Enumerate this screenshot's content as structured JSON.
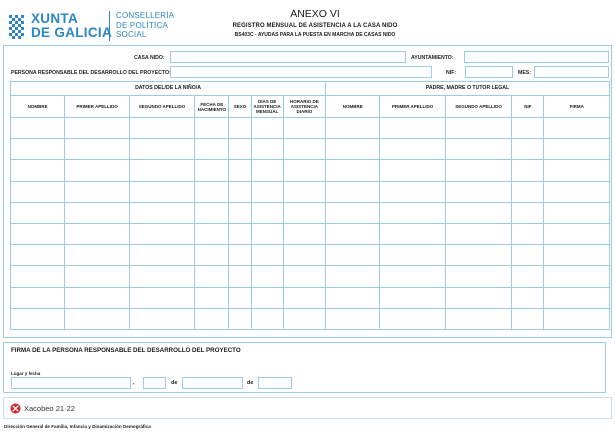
{
  "header": {
    "logo_line1": "XUNTA",
    "logo_line2": "DE GALICIA",
    "dept_line1": "CONSELLERÍA",
    "dept_line2": "DE POLÍTICA",
    "dept_line3": "SOCIAL",
    "annex": "ANEXO VI",
    "title": "REGISTRO MENSUAL DE ASISTENCIA A LA CASA NIDO",
    "subtitle": "BS403C - AYUDAS PARA LA PUESTA EN MARCHA DE CASAS NIDO"
  },
  "form": {
    "casa_nido_label": "CASA NIDO:",
    "ayuntamiento_label": "AYUNTAMIENTO:",
    "responsable_label": "PERSONA RESPONSABLE DEL DESARROLLO DEL PROYECTO:",
    "nif_label": "NIF:",
    "mes_label": "MES:"
  },
  "table": {
    "group_left": "DATOS DEL/DE LA NIÑO/A",
    "group_right": "PADRE, MADRE O TUTOR LEGAL",
    "columns_left": [
      "NOMBRE",
      "PRIMER APELLIDO",
      "SEGUNDO APELLIDO",
      "FECHA DE NACIMIENTO",
      "SEXO",
      "DÍAS DE ASISTENCIA MENSUAL",
      "HORARIO DE ASISTENCIA DIARIO"
    ],
    "columns_right": [
      "NOMBRE",
      "PRIMER APELLIDO",
      "SEGUNDO APELLIDO",
      "NIF",
      "FIRMA"
    ]
  },
  "signature": {
    "title": "FIRMA DE LA PERSONA RESPONSABLE DEL DESARROLLO DEL PROYECTO",
    "place_label": "Lugar y fecha",
    "comma": ",",
    "de1": "de",
    "de2": "de"
  },
  "xacobeo": {
    "text": "Xacobeo 21·22"
  },
  "footer": {
    "text": "Dirección General de Familia, Infancia y Dinamización Demográfica"
  },
  "colors": {
    "accent": "#2b86c8",
    "border": "#9ccbe8",
    "xacobeo_red": "#d9232d"
  }
}
